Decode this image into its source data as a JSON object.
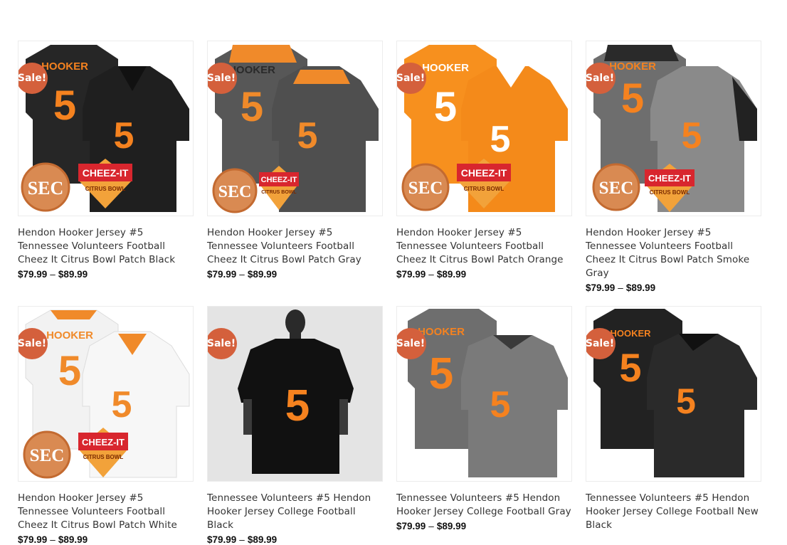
{
  "colors": {
    "sale_badge": "#d4603c",
    "accent_orange": "#f5821f"
  },
  "products": [
    {
      "badge": "Sale!",
      "title": "Hendon Hooker Jersey #5 Tennessee Volunteers Football Cheez It Citrus Bowl Patch Black",
      "price_min": "$79.99",
      "price_sep": "–",
      "price_max": "$89.99",
      "name_on_back": "HOOKER",
      "number": "5",
      "sec_patch": "SEC",
      "bowl_patch": {
        "line1": "CHEEZ-IT",
        "line2": "CITRUS BOWL"
      },
      "colorway": "black"
    },
    {
      "badge": "Sale!",
      "title": "Hendon Hooker Jersey #5 Tennessee Volunteers Football Cheez It Citrus Bowl Patch Gray",
      "price_min": "$79.99",
      "price_sep": "–",
      "price_max": "$89.99",
      "name_on_back": "HOOKER",
      "number": "5",
      "sec_patch": "SEC",
      "bowl_patch": {
        "line1": "CHEEZ-IT",
        "line2": "CITRUS BOWL"
      },
      "colorway": "gray"
    },
    {
      "badge": "Sale!",
      "title": "Hendon Hooker Jersey #5 Tennessee Volunteers Football Cheez It Citrus Bowl Patch Orange",
      "price_min": "$79.99",
      "price_sep": "–",
      "price_max": "$89.99",
      "name_on_back": "HOOKER",
      "number": "5",
      "sec_patch": "SEC",
      "bowl_patch": {
        "line1": "CHEEZ-IT",
        "line2": "CITRUS BOWL"
      },
      "colorway": "orange"
    },
    {
      "badge": "Sale!",
      "title": "Hendon Hooker Jersey #5 Tennessee Volunteers Football Cheez It Citrus Bowl Patch Smoke Gray",
      "price_min": "$79.99",
      "price_sep": "–",
      "price_max": "$89.99",
      "name_on_back": "HOOKER",
      "number": "5",
      "sec_patch": "SEC",
      "bowl_patch": {
        "line1": "CHEEZ-IT",
        "line2": "CITRUS BOWL"
      },
      "colorway": "smoke"
    },
    {
      "badge": "Sale!",
      "title": "Hendon Hooker Jersey #5 Tennessee Volunteers Football Cheez It Citrus Bowl Patch White",
      "price_min": "$79.99",
      "price_sep": "–",
      "price_max": "$89.99",
      "name_on_back": "HOOKER",
      "number": "5",
      "sec_patch": "SEC",
      "bowl_patch": {
        "line1": "CHEEZ-IT",
        "line2": "CITRUS BOWL"
      },
      "colorway": "white"
    },
    {
      "badge": "Sale!",
      "title": "Tennessee Volunteers #5 Hendon Hooker Jersey College Football Black",
      "price_min": "$79.99",
      "price_sep": "–",
      "price_max": "$89.99",
      "number": "5",
      "colorway": "black-photo"
    },
    {
      "badge": "Sale!",
      "title": "Tennessee Volunteers #5 Hendon Hooker Jersey College Football Gray",
      "price_min": "$79.99",
      "price_sep": "–",
      "price_max": "$89.99",
      "name_on_back": "HOOKER",
      "number": "5",
      "colorway": "gray-plain"
    },
    {
      "badge": "Sale!",
      "title": "Tennessee Volunteers #5 Hendon Hooker Jersey College Football New Black",
      "price_min": "",
      "price_sep": "",
      "price_max": "",
      "name_on_back": "HOOKER",
      "number": "5",
      "colorway": "newblack"
    }
  ]
}
